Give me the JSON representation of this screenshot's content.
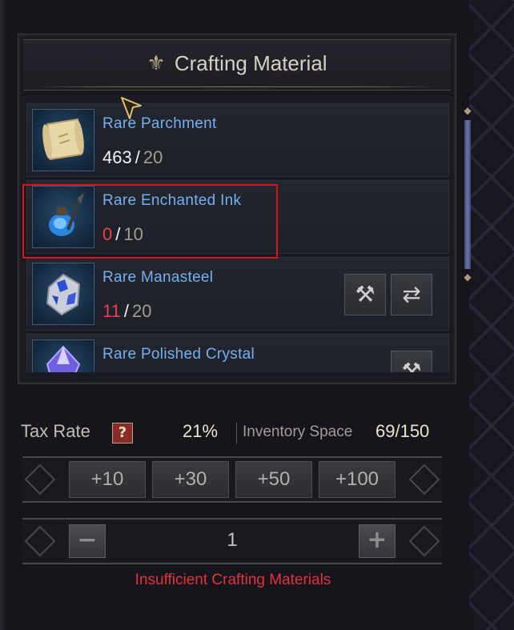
{
  "header": {
    "title": "Crafting Material",
    "icon": "fleur-de-lis-icon"
  },
  "materials": [
    {
      "name": "Rare Parchment",
      "have": "463",
      "need": "20",
      "sufficient": true,
      "icon": "parchment-scroll-icon"
    },
    {
      "name": "Rare Enchanted Ink",
      "have": "0",
      "need": "10",
      "sufficient": false,
      "icon": "ink-bottle-icon"
    },
    {
      "name": "Rare Manasteel",
      "have": "11",
      "need": "20",
      "sufficient": false,
      "icon": "manasteel-crystal-icon",
      "actions": [
        "craft-hammer-icon",
        "exchange-arrows-icon"
      ]
    },
    {
      "name": "Rare Polished Crystal",
      "icon": "polished-crystal-icon",
      "actions": [
        "craft-hammer-icon"
      ]
    }
  ],
  "tax": {
    "label": "Tax Rate",
    "help": "?",
    "value": "21%"
  },
  "inventory": {
    "label": "Inventory Space",
    "value": "69/150"
  },
  "quick_add": [
    "+10",
    "+30",
    "+50",
    "+100"
  ],
  "quantity": {
    "value": "1",
    "minus": "−",
    "plus": "+"
  },
  "warning": "Insufficient Crafting Materials",
  "colors": {
    "name_blue": "#74b0ee",
    "insufficient_red": "#ec3f4f",
    "highlight_red": "#d8151f",
    "warning_red": "#e3323f"
  }
}
